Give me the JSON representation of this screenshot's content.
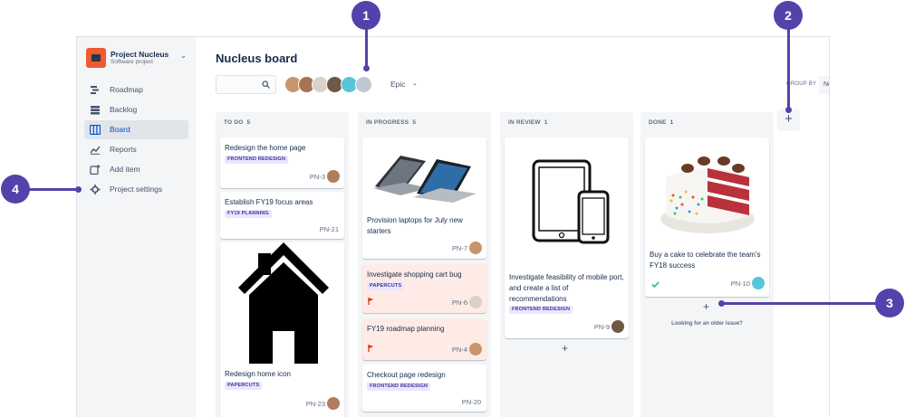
{
  "project": {
    "name": "Project Nucleus",
    "type": "Software project"
  },
  "sidebar": {
    "items": [
      {
        "label": "Roadmap",
        "icon": "roadmap-icon"
      },
      {
        "label": "Backlog",
        "icon": "backlog-icon"
      },
      {
        "label": "Board",
        "icon": "board-icon",
        "active": true
      },
      {
        "label": "Reports",
        "icon": "reports-icon"
      },
      {
        "label": "Add item",
        "icon": "add-item-icon"
      },
      {
        "label": "Project settings",
        "icon": "gear-icon"
      }
    ]
  },
  "header": {
    "title": "Nucleus board",
    "epic_filter": "Epic",
    "group_by_label": "GROUP BY",
    "group_by_value": "No"
  },
  "columns": [
    {
      "title": "TO DO",
      "count": "5",
      "cards": [
        {
          "title": "Redesign the home page",
          "epic": "FRONTEND REDESIGN",
          "key": "PN-3"
        },
        {
          "title": "Establish FY19 focus areas",
          "epic": "FY19 PLANNING",
          "key": "PN-21"
        },
        {
          "title": "Redesign home icon",
          "epic": "PAPERCUTS",
          "key": "PN-23"
        }
      ]
    },
    {
      "title": "IN PROGRESS",
      "count": "5",
      "cards": [
        {
          "title": "Provision laptops for July new starters",
          "key": "PN-7"
        },
        {
          "title": "Investigate shopping cart bug",
          "epic": "PAPERCUTS",
          "key": "PN-6"
        },
        {
          "title": "FY19 roadmap planning",
          "key": "PN-4"
        },
        {
          "title": "Checkout page redesign",
          "epic": "FRONTEND REDESIGN",
          "key": "PN-20"
        }
      ]
    },
    {
      "title": "IN REVIEW",
      "count": "1",
      "cards": [
        {
          "title": "Investigate feasibility of mobile port, and create a list of recommendations",
          "epic": "FRONTEND REDESIGN",
          "key": "PN-9"
        }
      ]
    },
    {
      "title": "DONE",
      "count": "1",
      "cards": [
        {
          "title": "Buy a cake to celebrate the team's FY18 success",
          "key": "PN-10"
        }
      ],
      "footer": "Looking for an older issue?"
    }
  ],
  "callouts": [
    "1",
    "2",
    "3",
    "4"
  ],
  "colors": {
    "accent": "#5243aa",
    "epic_badge_bg": "#eae6ff",
    "epic_badge_text": "#403294",
    "flagged_card": "#ffebe6",
    "sidebar_bg": "#f4f5f7",
    "active_link": "#0052cc"
  }
}
